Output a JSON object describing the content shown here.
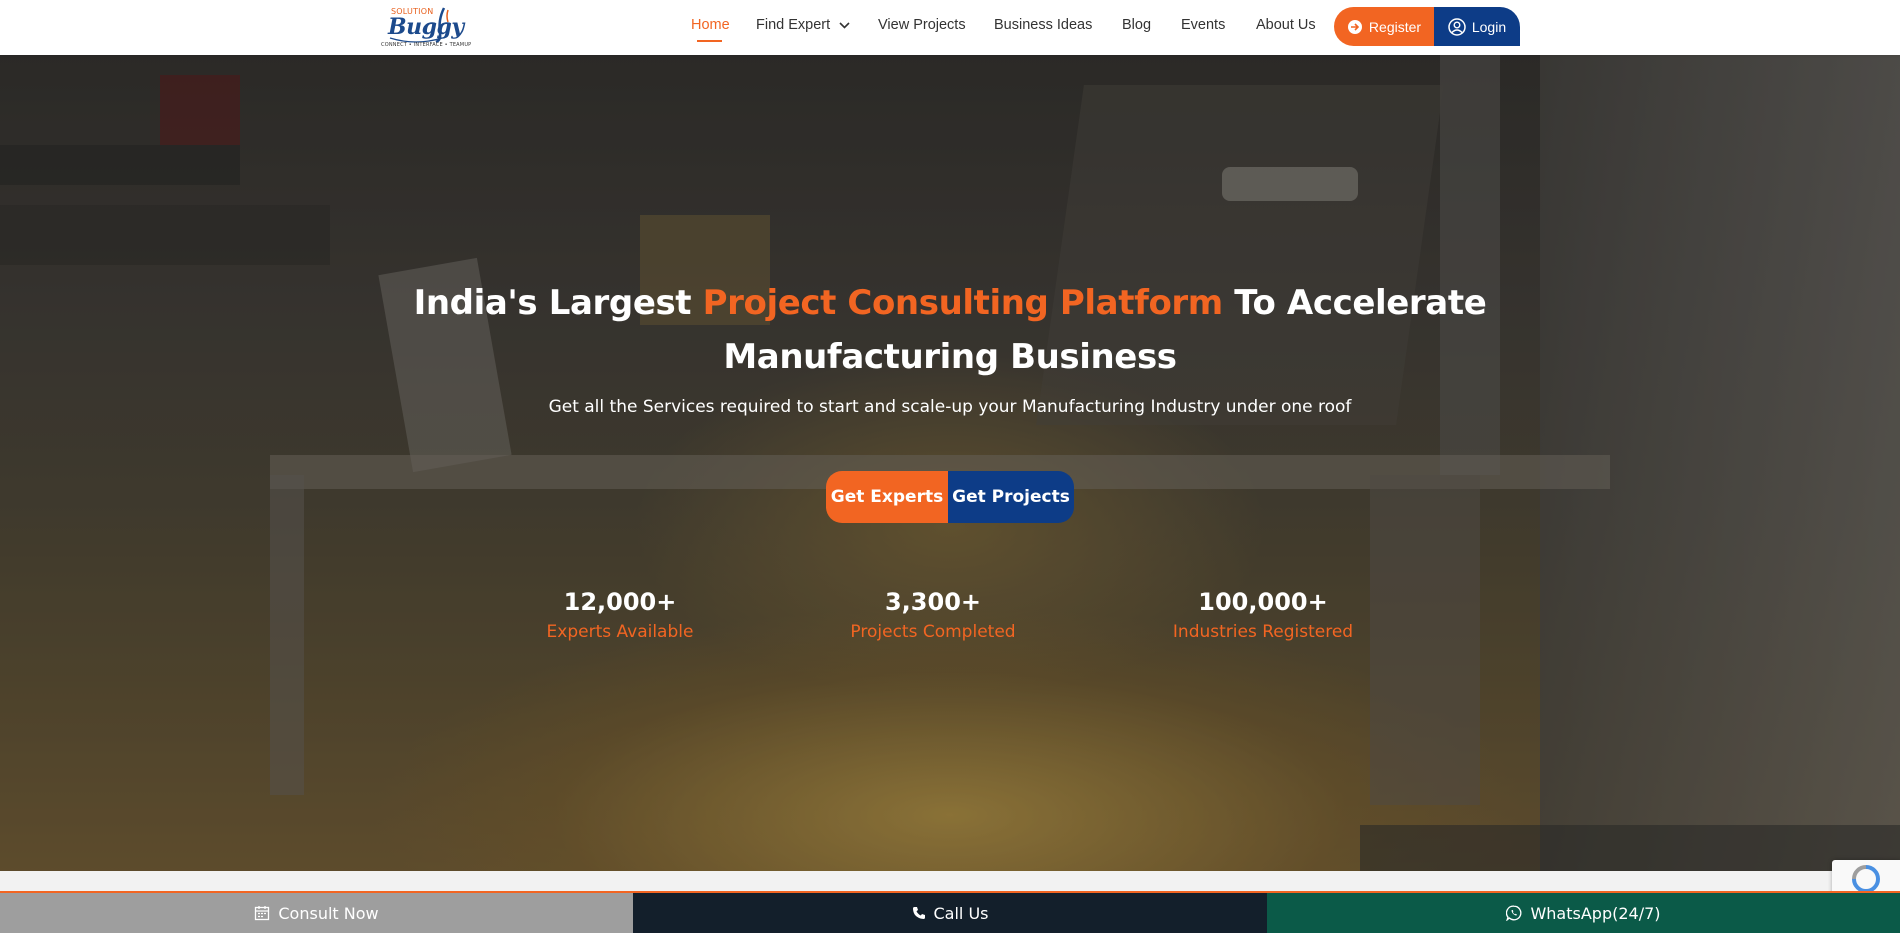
{
  "header": {
    "logo": {
      "top_text": "SOLUTION",
      "main_text": "Buggy",
      "tagline": "CONNECT • INTERFACE • TEAMUP"
    },
    "nav": [
      {
        "label": "Home",
        "active": true
      },
      {
        "label": "Find Expert",
        "has_dropdown": true
      },
      {
        "label": "View Projects"
      },
      {
        "label": "Business Ideas"
      },
      {
        "label": "Blog"
      },
      {
        "label": "Events"
      },
      {
        "label": "About Us"
      }
    ],
    "register_label": "Register",
    "login_label": "Login"
  },
  "hero": {
    "title_part1": "India's Largest ",
    "title_highlight": "Project Consulting Platform",
    "title_part2": " To Accelerate",
    "title_line2": "Manufacturing Business",
    "subtitle": "Get all the Services required to start and scale-up your Manufacturing Industry under one roof",
    "cta_primary": "Get Experts",
    "cta_secondary": "Get Projects",
    "stats": [
      {
        "number": "12,000+",
        "label": "Experts Available"
      },
      {
        "number": "3,300+",
        "label": "Projects Completed"
      },
      {
        "number": "100,000+",
        "label": "Industries Registered"
      }
    ]
  },
  "bottom_bar": {
    "consult": "Consult Now",
    "call": "Call Us",
    "whatsapp": "WhatsApp(24/7)"
  },
  "colors": {
    "accent": "#f26522",
    "brand_blue": "#0d3c87",
    "consult_bg": "#9e9e9e",
    "call_bg": "#131f2b",
    "whatsapp_bg": "#0b5a48"
  },
  "icons": {
    "register": "arrow-right-circle-icon",
    "login": "user-circle-icon",
    "consult": "calendar-icon",
    "call": "phone-icon",
    "whatsapp": "whatsapp-icon",
    "dropdown": "chevron-down-icon"
  }
}
